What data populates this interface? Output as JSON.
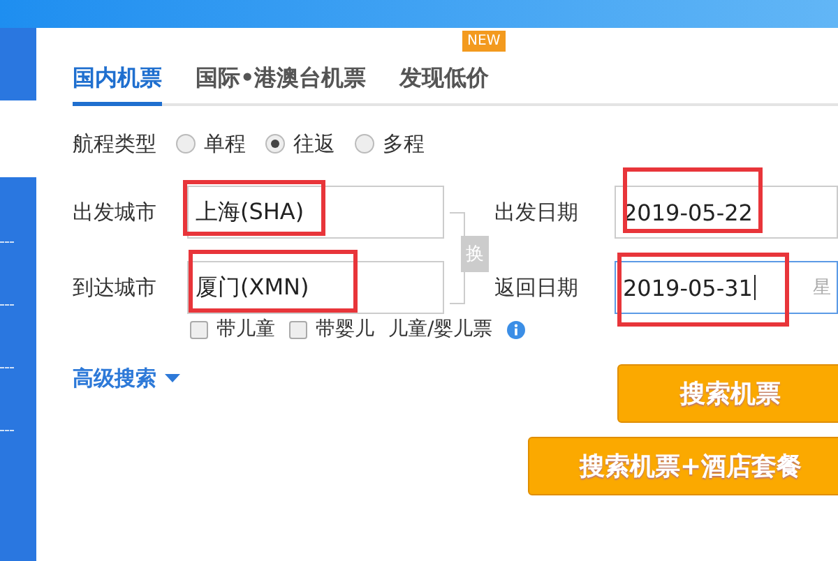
{
  "tabs": [
    {
      "label": "国内机票",
      "selected": true
    },
    {
      "label": "国际•港澳台机票",
      "selected": false
    },
    {
      "label": "发现低价",
      "selected": false,
      "badge": "NEW"
    }
  ],
  "trip_type": {
    "label": "航程类型",
    "options": [
      {
        "label": "单程",
        "selected": false
      },
      {
        "label": "往返",
        "selected": true
      },
      {
        "label": "多程",
        "selected": false
      }
    ]
  },
  "rows": [
    {
      "city_label": "出发城市",
      "city": {
        "value": "上海(SHA)",
        "highlighted": true
      },
      "date_label": "出发日期",
      "date": {
        "value": "2019-05-22",
        "focused": false,
        "highlighted": true
      }
    },
    {
      "city_label": "到达城市",
      "city": {
        "value": "厦门(XMN)",
        "highlighted": true
      },
      "date_label": "返回日期",
      "date": {
        "value": "2019-05-31",
        "hint": "星",
        "focused": true,
        "highlighted": true
      }
    }
  ],
  "swap_button": "换",
  "passengers": [
    {
      "label": "带儿童",
      "checked": false
    },
    {
      "label": "带婴儿",
      "checked": false
    }
  ],
  "ticket_info": "儿童/婴儿票",
  "advanced_search": "高级搜索",
  "buttons": [
    "搜索机票",
    "搜索机票+酒店套餐"
  ]
}
